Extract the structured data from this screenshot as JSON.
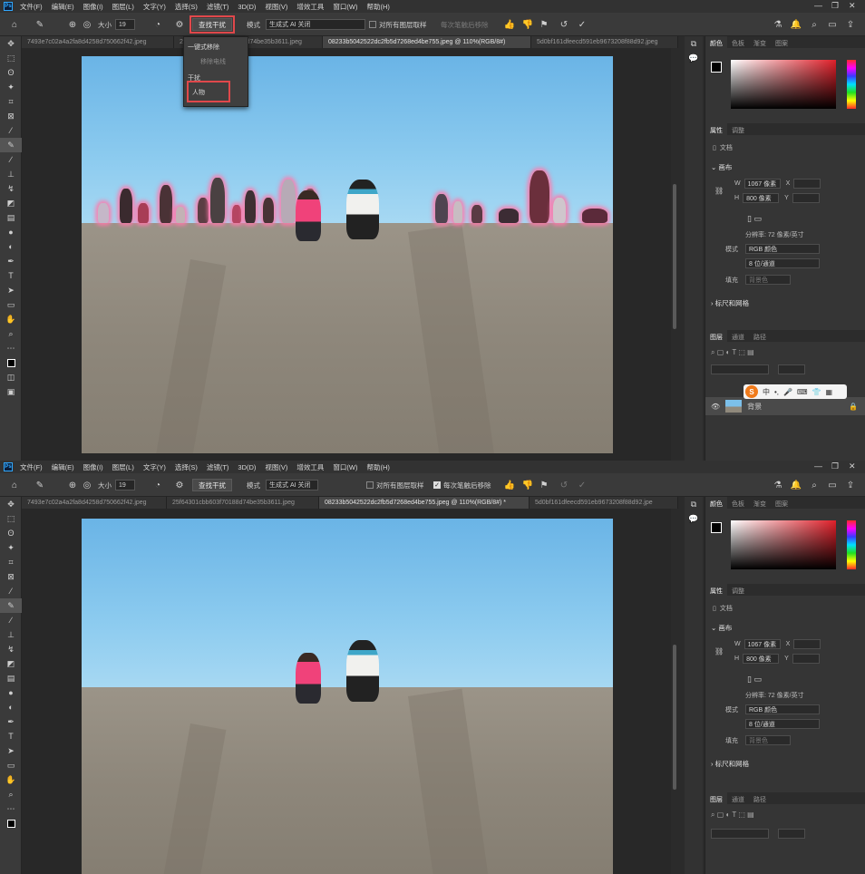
{
  "menu": [
    "文件(F)",
    "编辑(E)",
    "图像(I)",
    "图层(L)",
    "文字(Y)",
    "选择(S)",
    "滤镜(T)",
    "3D(D)",
    "视图(V)",
    "增效工具",
    "窗口(W)",
    "帮助(H)"
  ],
  "options_top": {
    "size_label": "大小",
    "size_value": "19",
    "mode_button": "查找干扰",
    "mode_label": "模式",
    "mode_value": "生成式 AI 关闭",
    "sample_all": "对所有图层取样",
    "auto_enhance": "每次笔触后移除"
  },
  "options_bottom": {
    "size_label": "大小",
    "size_value": "19",
    "mode_button": "查找干扰",
    "mode_label": "模式",
    "mode_value": "生成式 AI 关闭",
    "sample_all": "对所有图层取样",
    "auto_enhance": "每次笔触后移除"
  },
  "dropdown": {
    "items": [
      "一键式移除",
      "移除电线",
      "干扰",
      "人物"
    ],
    "highlighted": "人物"
  },
  "tabs_top": [
    "7493e7c02a4a2fa8d4258d750662f42.jpeg",
    "25f64301cbb603f70188d74be35b3611.jpeg",
    "08233b5042522dc2fb5d7268ed4be755.jpeg @ 110%(RGB/8#)",
    "5d0bf161dfeecd591eb9673208f88d92.jpeg"
  ],
  "tabs_bottom": [
    "7493e7c02a4a2fa8d4258d750662f42.jpeg",
    "25f64301cbb603f70188d74be35b3611.jpeg",
    "08233b5042522dc2fb5d7268ed4be755.jpeg @ 110%(RGB/8#) *",
    "5d0bf161dfeecd591eb9673208f88d92.jpe"
  ],
  "panel": {
    "color_tabs": [
      "颜色",
      "色板",
      "渐变",
      "图案"
    ],
    "props_tabs": [
      "属性",
      "调整"
    ],
    "doc_label": "文档",
    "canvas_header": "画布",
    "w_label": "W",
    "w_value": "1067 像素",
    "h_label": "H",
    "h_value": "800 像素",
    "x_label": "X",
    "y_label": "Y",
    "resolution": "分辨率: 72 像素/英寸",
    "mode_label": "模式",
    "mode_value": "RGB 颜色",
    "depth_value": "8 位/通道",
    "fill_label": "填充",
    "fill_value": "背景色",
    "rulers_header": "标尺和网格",
    "layer_tabs": [
      "图层",
      "通道",
      "路径"
    ],
    "layer_name": "背景"
  },
  "ime": {
    "label": "中"
  },
  "colors": {
    "accent_red": "#e0484b",
    "halo_pink": "#ff78aa"
  }
}
